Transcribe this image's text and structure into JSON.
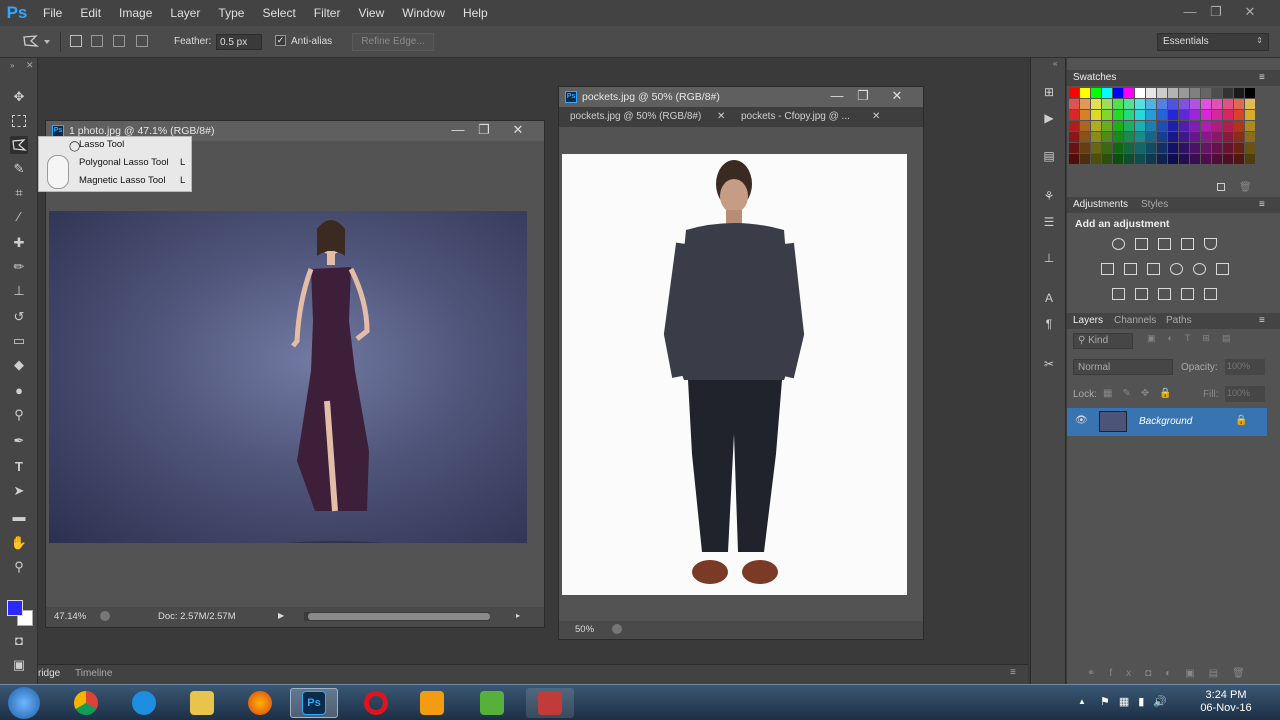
{
  "app": {
    "logo": "Ps"
  },
  "menu": [
    "File",
    "Edit",
    "Image",
    "Layer",
    "Type",
    "Select",
    "Filter",
    "View",
    "Window",
    "Help"
  ],
  "window_controls": {
    "minimize": "—",
    "restore": "❐",
    "close": "✕"
  },
  "options_bar": {
    "feather_label": "Feather:",
    "feather_value": "0.5 px",
    "antialias_label": "Anti-alias",
    "antialias_checked": true,
    "refine_edge": "Refine Edge...",
    "workspace": "Essentials"
  },
  "doc1": {
    "title": "1 photo.jpg @ 47.1% (RGB/8#)",
    "zoom": "47.14%",
    "doc_size": "Doc: 2.57M/2.57M"
  },
  "flyout": {
    "items": [
      {
        "label": "Lasso Tool",
        "key": "L"
      },
      {
        "label": "Polygonal Lasso Tool",
        "key": "L"
      },
      {
        "label": "Magnetic Lasso Tool",
        "key": "L"
      }
    ]
  },
  "doc2": {
    "title": "pockets.jpg @ 50% (RGB/8#)",
    "tabs": [
      "pockets.jpg @ 50% (RGB/8#)",
      "pockets - Cfopy.jpg @ ..."
    ],
    "zoom": "50%"
  },
  "bottom_panel": {
    "tabs": [
      "ridge",
      "Timeline"
    ]
  },
  "panels": {
    "swatches": {
      "title": "Swatches"
    },
    "adjustments": {
      "tabs": [
        "Adjustments",
        "Styles"
      ],
      "hint": "Add an adjustment"
    },
    "layers": {
      "tabs": [
        "Layers",
        "Channels",
        "Paths"
      ],
      "kind": "Kind",
      "blend_mode": "Normal",
      "opacity_label": "Opacity:",
      "opacity_value": "100%",
      "lock_label": "Lock:",
      "fill_label": "Fill:",
      "fill_value": "100%",
      "layer_name": "Background"
    }
  },
  "colors": {
    "foreground": "#2a2aff",
    "background": "#ffffff",
    "accent": "#3874b1"
  },
  "taskbar": {
    "apps": [
      "start-orb",
      "chrome",
      "internet-explorer",
      "file-explorer",
      "firefox",
      "photoshop",
      "opera",
      "media-player",
      "utorrent",
      "app"
    ],
    "time": "3:24 PM",
    "date": "06-Nov-16"
  }
}
